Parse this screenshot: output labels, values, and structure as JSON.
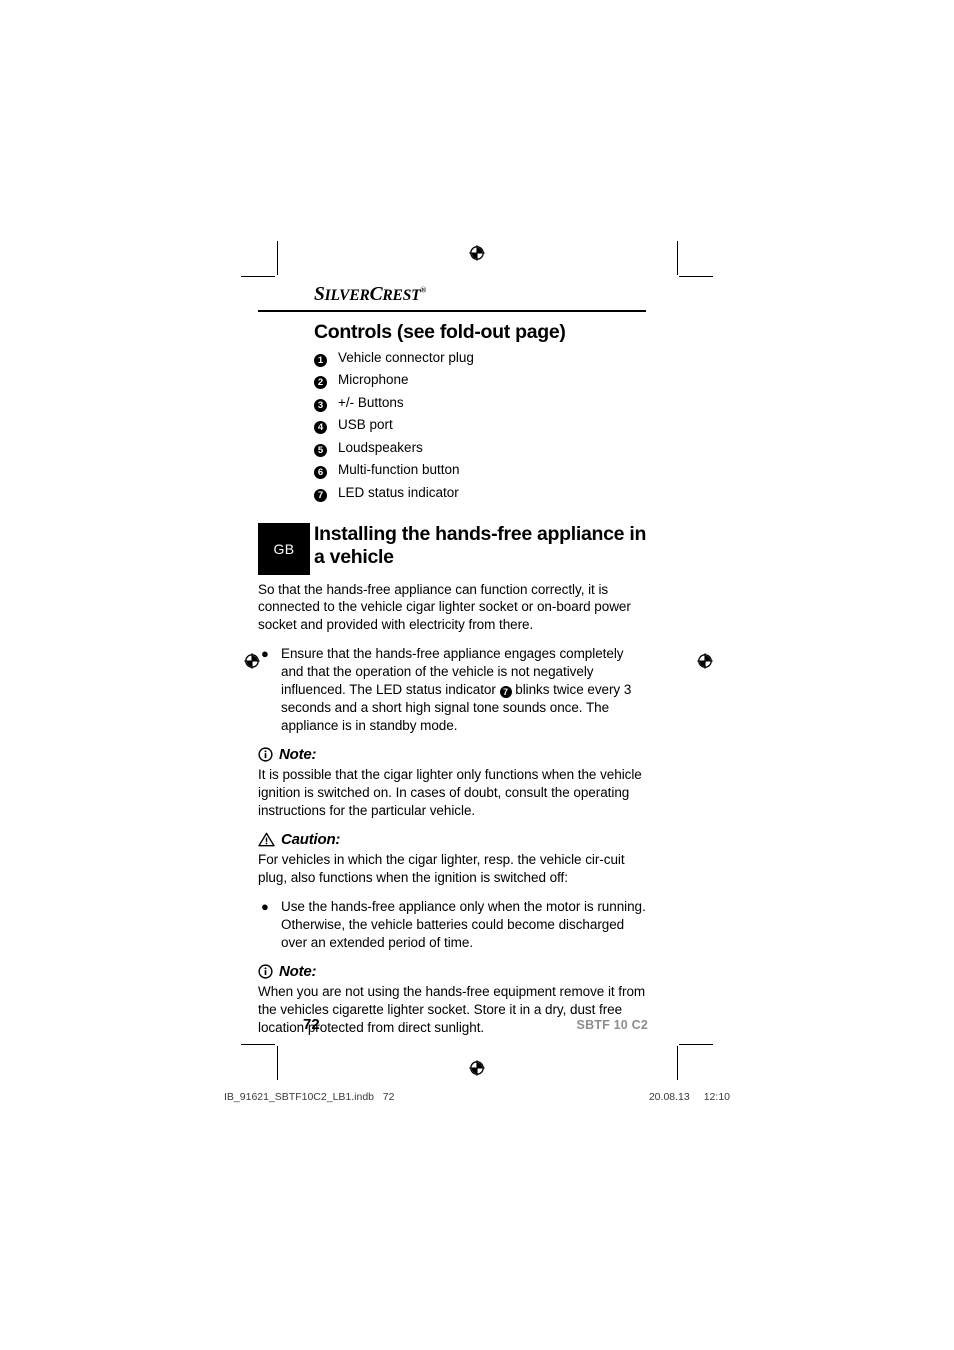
{
  "brand": {
    "name_part1": "S",
    "name_part2": "ILVER",
    "name_part3": "C",
    "name_part4": "REST",
    "registered_mark": "®"
  },
  "sections": {
    "controls": {
      "title": "Controls (see fold-out page)",
      "items": [
        {
          "number": "1",
          "label": "Vehicle connector plug"
        },
        {
          "number": "2",
          "label": "Microphone"
        },
        {
          "number": "3",
          "label": "+/- Buttons"
        },
        {
          "number": "4",
          "label": "USB port"
        },
        {
          "number": "5",
          "label": "Loudspeakers"
        },
        {
          "number": "6",
          "label": "Multi-function button"
        },
        {
          "number": "7",
          "label": "LED status indicator"
        }
      ]
    },
    "installing": {
      "lang_badge": "GB",
      "title": "Installing the hands-free appliance in a vehicle",
      "intro": "So that the hands-free appliance can function correctly, it is connected to the vehicle cigar lighter socket or on-board power socket and provided with electricity from there.",
      "bullet1_before": "Ensure that the hands-free appliance engages completely and that the operation of the vehicle is not negatively influenced. The LED status indicator ",
      "bullet1_ref": "7",
      "bullet1_after": " blinks twice every 3 seconds and a short high signal tone sounds once. The appliance is in standby mode.",
      "note1": {
        "icon": "info-circle-icon",
        "label": "Note:",
        "text": "It is possible that the cigar lighter only functions when the vehicle ignition is switched on. In cases of doubt, consult the operating instructions for the particular vehicle."
      },
      "caution": {
        "icon": "warning-triangle-icon",
        "label": "Caution:",
        "text": "For vehicles in which the cigar lighter, resp. the vehicle cir-cuit plug, also functions when the ignition is switched off:",
        "bullet": "Use the hands-free appliance only when the motor is running. Otherwise, the vehicle batteries could become discharged over an extended period of time."
      },
      "note2": {
        "icon": "info-circle-icon",
        "label": "Note:",
        "text": "When you are not using the hands-free equipment remove it from the vehicles cigarette lighter socket. Store it in a dry, dust free location protected from direct sunlight."
      },
      "bullet_glyph": "●"
    }
  },
  "footer": {
    "page_number": "72",
    "model": "SBTF 10 C2"
  },
  "print_slug": {
    "filename": "IB_91621_SBTF10C2_LB1.indb",
    "page": "72",
    "date": "20.08.13",
    "time": "12:10"
  }
}
